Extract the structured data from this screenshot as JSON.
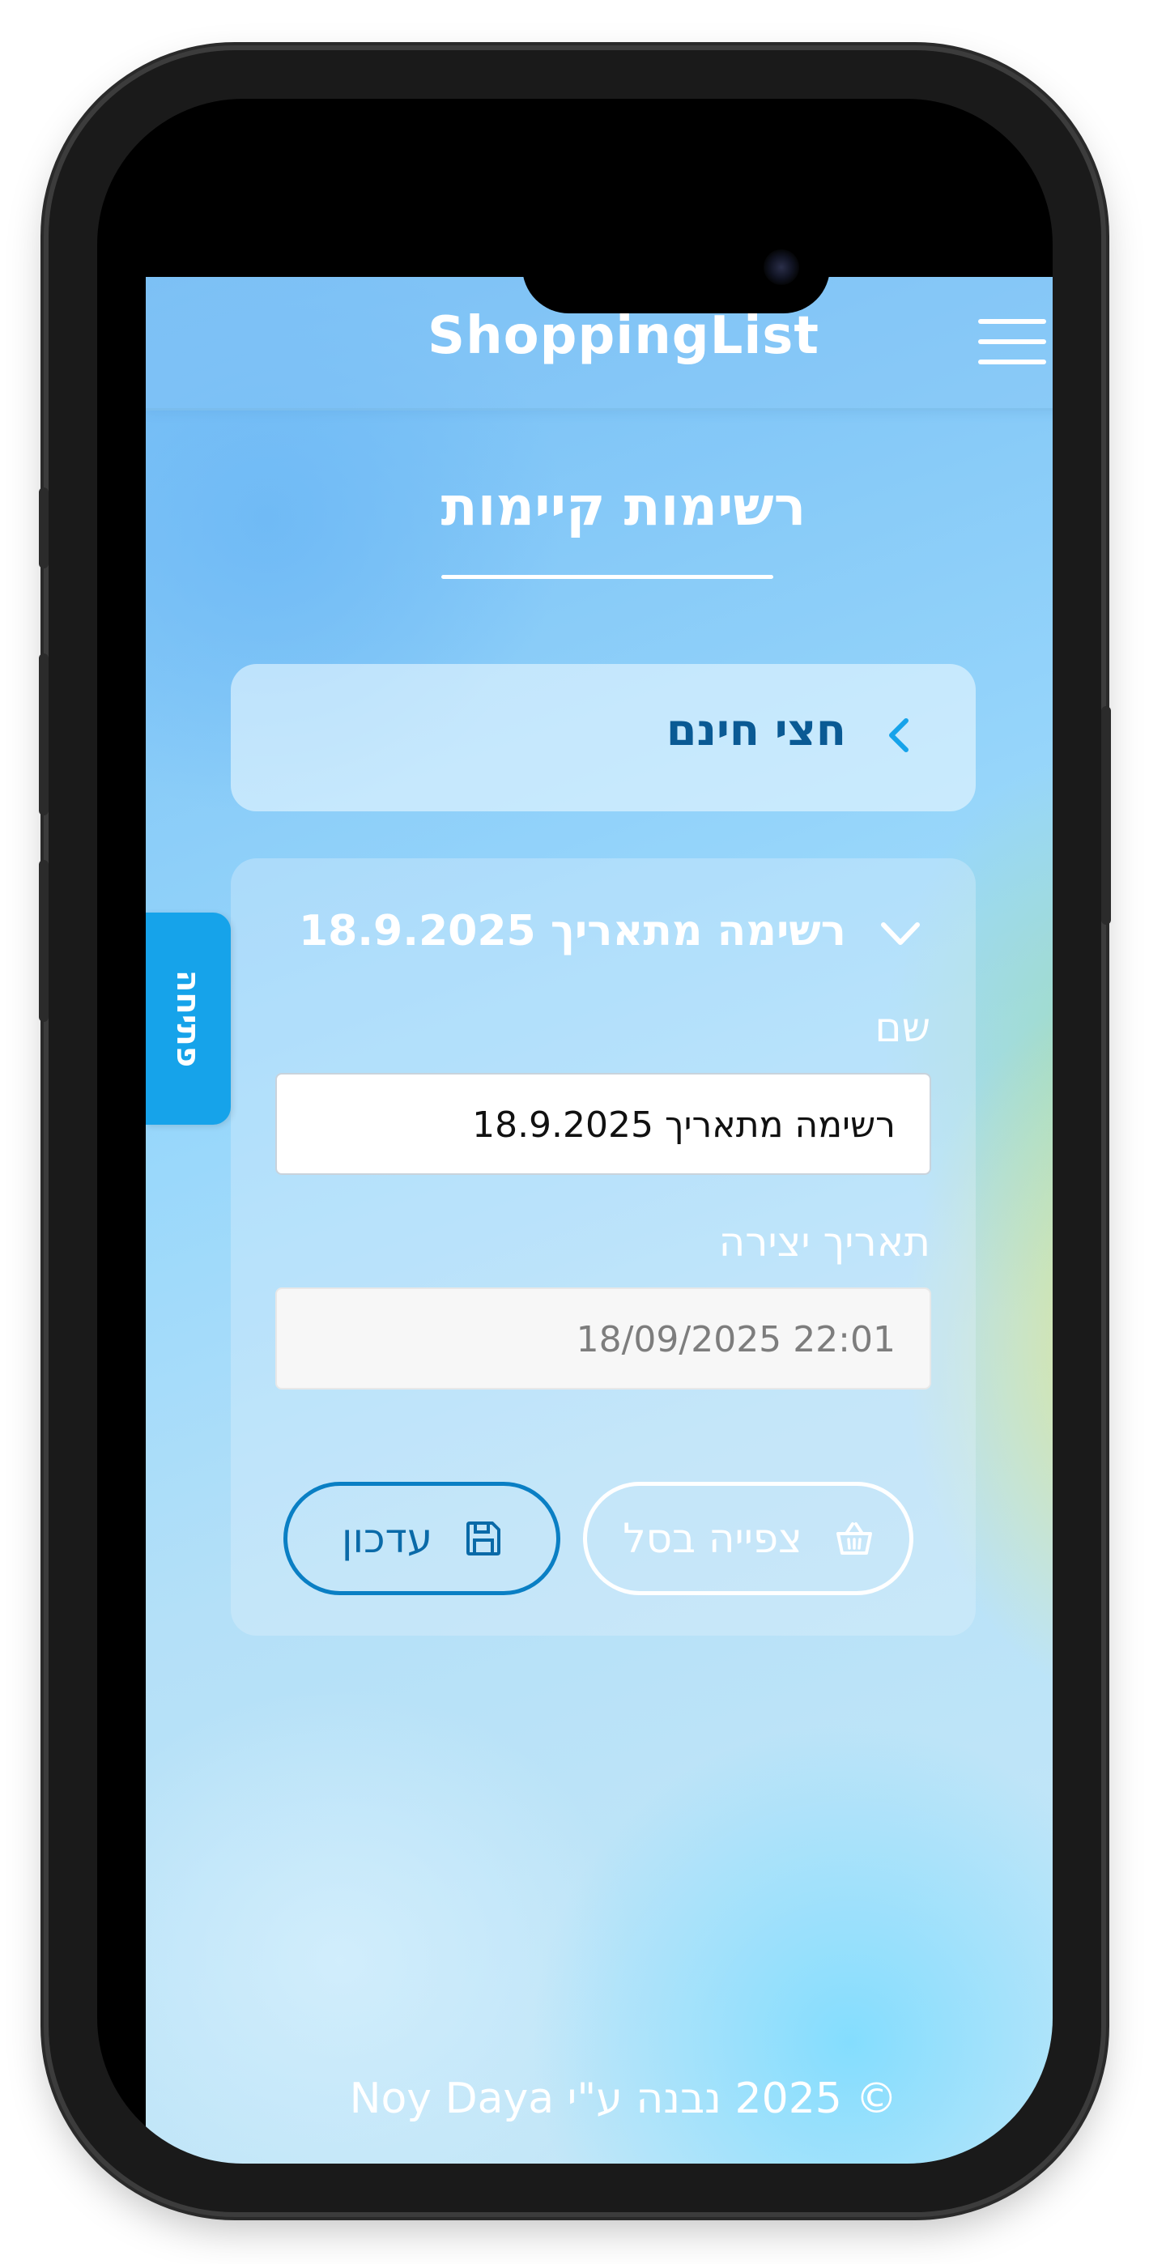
{
  "app": {
    "brand": "ShoppingList"
  },
  "page": {
    "title": "רשימות קיימות"
  },
  "lists": [
    {
      "name": "חצי חינם",
      "state": "collapsed"
    }
  ],
  "expanded_list": {
    "title": "רשימה מתאריך 18.9.2025",
    "name_label": "שם",
    "name_value": "רשימה מתאריך 18.9.2025",
    "date_label": "תאריך יצירה",
    "date_value": "22:01 18/09/2025",
    "view_basket_label": "צפייה בסל",
    "update_label": "עדכון"
  },
  "side_tab": {
    "label": "פתיחה"
  },
  "footer": {
    "text": "© 2025 נבנה ע\"י Noy Daya"
  },
  "icons": {
    "menu": "hamburger-menu-icon",
    "list_chevron": "chevron-left-icon",
    "expand_chevron": "chevron-down-icon",
    "basket": "basket-icon",
    "save": "floppy-disk-icon"
  },
  "colors": {
    "accent": "#16a3ea",
    "primary_text": "#0a5a94",
    "update_border": "#0a7fc4"
  }
}
